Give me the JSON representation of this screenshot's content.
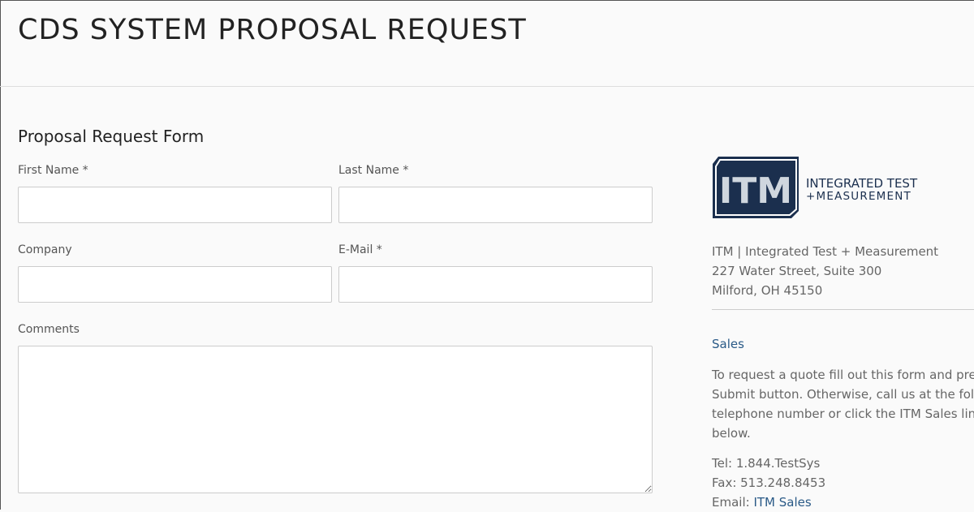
{
  "header": {
    "title": "CDS SYSTEM PROPOSAL REQUEST"
  },
  "form": {
    "title": "Proposal Request Form",
    "first_name_label": "First Name *",
    "first_name_value": "",
    "last_name_label": "Last Name *",
    "last_name_value": "",
    "company_label": "Company",
    "company_value": "",
    "email_label": "E-Mail *",
    "email_value": "",
    "comments_label": "Comments",
    "comments_value": ""
  },
  "sidebar": {
    "logo": {
      "mark_text": "ITM",
      "line1": "INTEGRATED TEST",
      "line2": "+MEASUREMENT",
      "mark_color": "#1b2f4e"
    },
    "address_lines": [
      "ITM | Integrated Test + Measurement",
      "227 Water Street, Suite 300",
      "Milford, OH 45150"
    ],
    "sales_heading": "Sales",
    "sales_text_lines": [
      "To request a quote fill out this form and press",
      "Submit button.  Otherwise, call us at the follow",
      "telephone number or click the ITM Sales link",
      "below."
    ],
    "tel": "Tel: 1.844.TestSys",
    "fax": "Fax: 513.248.8453",
    "email_label": "Email: ",
    "email_link": "ITM Sales"
  },
  "colors": {
    "accent": "#2a5a87",
    "logo_navy": "#1b2f4e",
    "background": "#fafafa"
  }
}
